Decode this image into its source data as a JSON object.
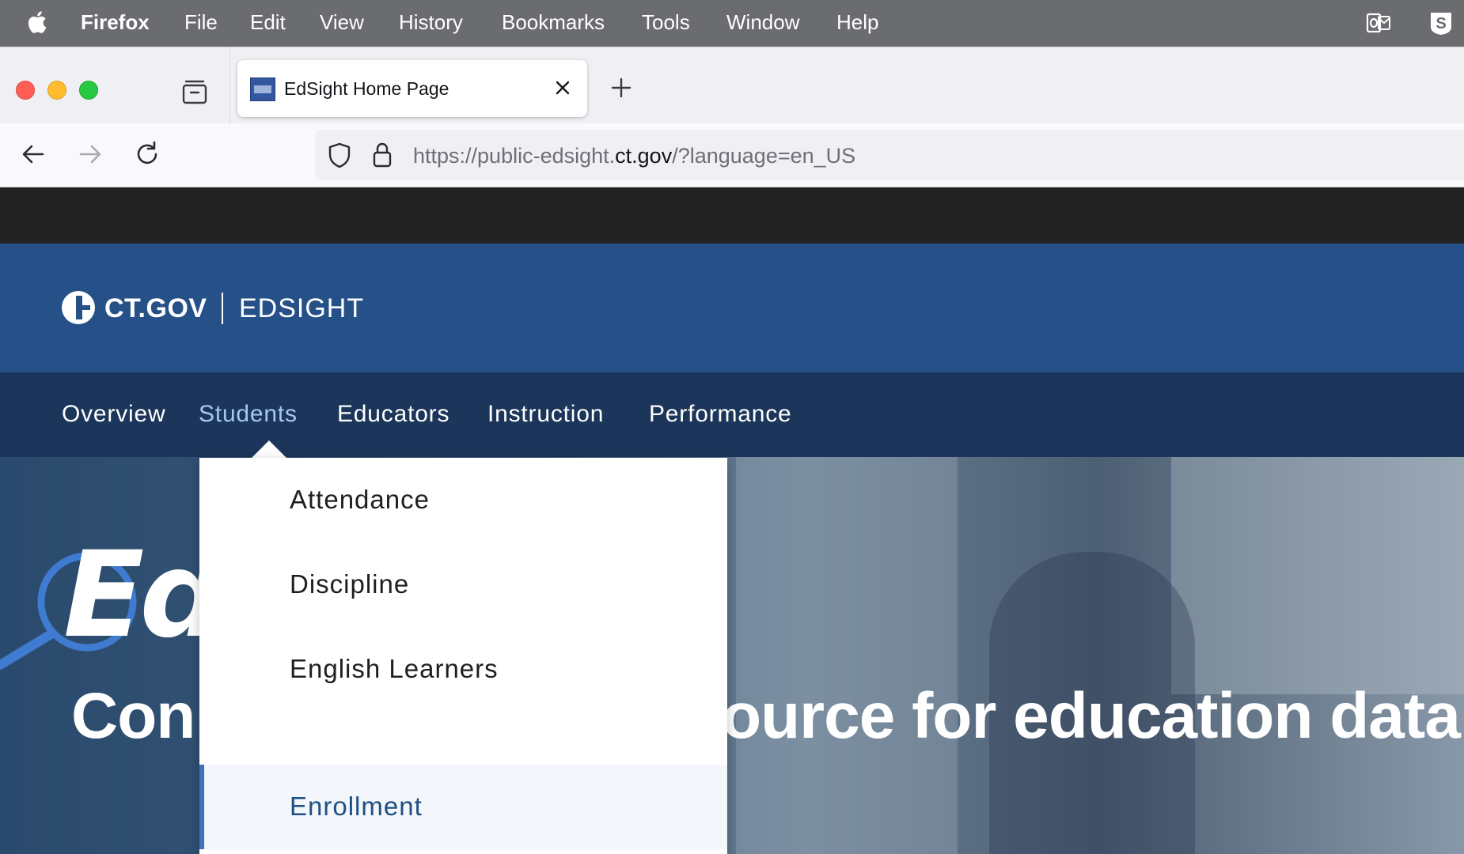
{
  "menubar": {
    "app_name": "Firefox",
    "items": [
      "File",
      "Edit",
      "View",
      "History",
      "Bookmarks",
      "Tools",
      "Window",
      "Help"
    ]
  },
  "browser": {
    "tab": {
      "title": "EdSight Home Page"
    },
    "url": {
      "prefix": "https://public-edsight.",
      "host": "ct.gov",
      "suffix": "/?language=en_US"
    }
  },
  "site": {
    "logo_text": "CT.GOV",
    "site_name": "EDSIGHT",
    "nav": [
      "Overview",
      "Students",
      "Educators",
      "Instruction",
      "Performance"
    ],
    "active_nav": "Students",
    "hero": {
      "logo_text": "EdS",
      "tagline_left": "Con",
      "tagline_right": "ource for education data"
    },
    "students_menu": {
      "items": [
        "Attendance",
        "Discipline",
        "English Learners",
        "Enrollment"
      ],
      "highlighted": "Enrollment"
    }
  },
  "colors": {
    "menubar_bg": "#6b6c70",
    "header_blue": "#255188",
    "nav_navy": "#1b365a",
    "active_nav_text": "#a6c8ee",
    "highlight_bar": "#3e73c0"
  }
}
